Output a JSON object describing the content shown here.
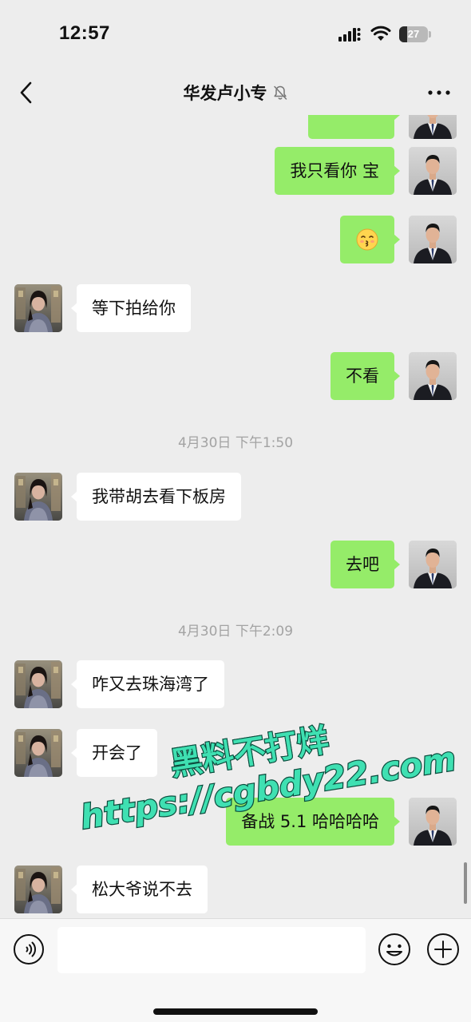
{
  "status_bar": {
    "time": "12:57",
    "battery_percent": "27",
    "battery_level": 0.27
  },
  "nav": {
    "title": "华发卢小专",
    "muted": true
  },
  "messages": [
    {
      "side": "self",
      "text": ""
    },
    {
      "side": "self",
      "text": "我只看你 宝"
    },
    {
      "side": "self",
      "type": "emoji",
      "emoji": "kissing-face",
      "text": "😚"
    },
    {
      "side": "other",
      "text": "等下拍给你"
    },
    {
      "side": "self",
      "text": "不看"
    },
    {
      "type": "timestamp",
      "text": "4月30日 下午1:50"
    },
    {
      "side": "other",
      "text": "我带胡去看下板房"
    },
    {
      "side": "self",
      "text": "去吧"
    },
    {
      "type": "timestamp",
      "text": "4月30日 下午2:09"
    },
    {
      "side": "other",
      "text": "咋又去珠海湾了"
    },
    {
      "side": "other",
      "text": "开会了"
    },
    {
      "side": "self",
      "text": "备战 5.1 哈哈哈哈"
    },
    {
      "side": "other",
      "text": "松大爷说不去"
    }
  ],
  "watermark": {
    "line1": "黑料不打烊",
    "line2": "https://cgbdy22.com",
    "color": "#3fe0b2"
  },
  "input_bar": {
    "placeholder": ""
  },
  "icons": {
    "back": "chevron-left-icon",
    "mute": "bell-off-icon",
    "more": "more-dots-icon",
    "voice": "voice-icon",
    "emoji": "emoji-icon",
    "plus": "plus-icon"
  },
  "colors": {
    "self_bubble": "#95ec69",
    "other_bubble": "#ffffff",
    "background": "#ededed"
  }
}
